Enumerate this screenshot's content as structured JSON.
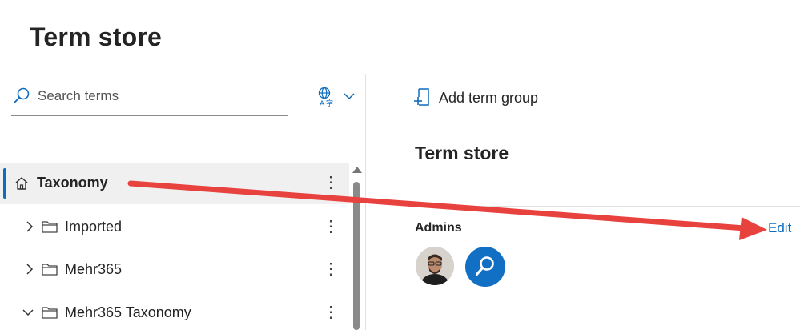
{
  "header": {
    "title": "Term store"
  },
  "left_pane": {
    "search": {
      "placeholder": "Search terms"
    },
    "language_icon": "language-translate-icon",
    "tree": {
      "root": {
        "label": "Taxonomy",
        "icon": "home-icon",
        "selected": true
      },
      "groups": [
        {
          "label": "Imported",
          "expanded": false
        },
        {
          "label": "Mehr365",
          "expanded": false
        },
        {
          "label": "Mehr365 Taxonomy",
          "expanded": true
        }
      ]
    }
  },
  "right_pane": {
    "add_group_label": "Add term group",
    "section_title": "Term store",
    "admins_label": "Admins",
    "edit_label": "Edit"
  },
  "annotation": {
    "color": "#e8423f"
  }
}
